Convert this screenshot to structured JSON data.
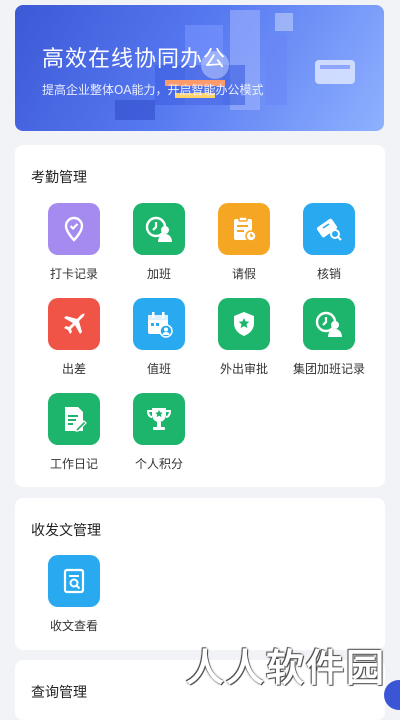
{
  "banner": {
    "title": "高效在线协同办公",
    "subtitle": "提高企业整体OA能力，开启智能办公模式"
  },
  "sections": [
    {
      "title": "考勤管理",
      "items": [
        {
          "label": "打卡记录",
          "icon": "location-pin-icon",
          "color": "#a58bf0"
        },
        {
          "label": "加班",
          "icon": "clock-person-icon",
          "color": "#1db46b"
        },
        {
          "label": "请假",
          "icon": "clipboard-clock-icon",
          "color": "#f5a623"
        },
        {
          "label": "核销",
          "icon": "ticket-search-icon",
          "color": "#29a9f0"
        },
        {
          "label": "出差",
          "icon": "airplane-icon",
          "color": "#ef5446"
        },
        {
          "label": "值班",
          "icon": "calendar-person-icon",
          "color": "#29a9f0"
        },
        {
          "label": "外出审批",
          "icon": "shield-star-icon",
          "color": "#1db46b"
        },
        {
          "label": "集团加班记录",
          "icon": "clock-person-icon",
          "color": "#1db46b"
        },
        {
          "label": "工作日记",
          "icon": "document-pen-icon",
          "color": "#1db46b"
        },
        {
          "label": "个人积分",
          "icon": "trophy-icon",
          "color": "#1db46b"
        }
      ]
    },
    {
      "title": "收发文管理",
      "items": [
        {
          "label": "收文查看",
          "icon": "document-search-icon",
          "color": "#29a9f0"
        }
      ]
    },
    {
      "title": "查询管理",
      "items": []
    }
  ],
  "watermark": "人人软件园"
}
